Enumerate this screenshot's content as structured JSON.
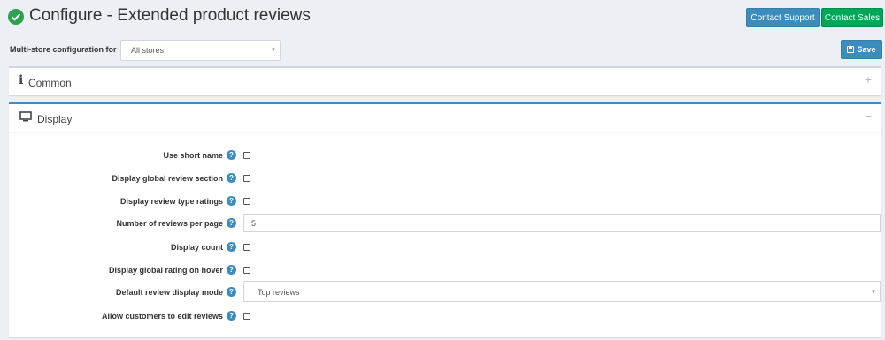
{
  "header": {
    "title": "Configure - Extended product reviews",
    "contact_support": "Contact Support",
    "contact_sales": "Contact Sales"
  },
  "multistore": {
    "label": "Multi-store configuration for",
    "selected": "All stores"
  },
  "save_label": "Save",
  "panels": {
    "common": {
      "title": "Common"
    },
    "display": {
      "title": "Display"
    }
  },
  "settings": {
    "use_short_name": {
      "label": "Use short name",
      "checked": false
    },
    "display_global_review_section": {
      "label": "Display global review section",
      "checked": false
    },
    "display_review_type_ratings": {
      "label": "Display review type ratings",
      "checked": false
    },
    "number_of_reviews_per_page": {
      "label": "Number of reviews per page",
      "value": "5"
    },
    "display_count": {
      "label": "Display count",
      "checked": false
    },
    "display_global_rating_on_hover": {
      "label": "Display global rating on hover",
      "checked": false
    },
    "default_review_display_mode": {
      "label": "Default review display mode",
      "value": "Top reviews"
    },
    "allow_customers_to_edit_reviews": {
      "label": "Allow customers to edit reviews",
      "checked": false
    }
  },
  "colors": {
    "primary": "#3c8dbc",
    "success": "#00a65a",
    "background": "#ecf0f5"
  },
  "icons": {
    "title": "check-circle-icon",
    "save": "floppy-disk-icon",
    "common": "info-icon",
    "display": "monitor-icon",
    "help": "question-mark-icon",
    "expand": "plus-icon",
    "collapse": "minus-icon"
  }
}
